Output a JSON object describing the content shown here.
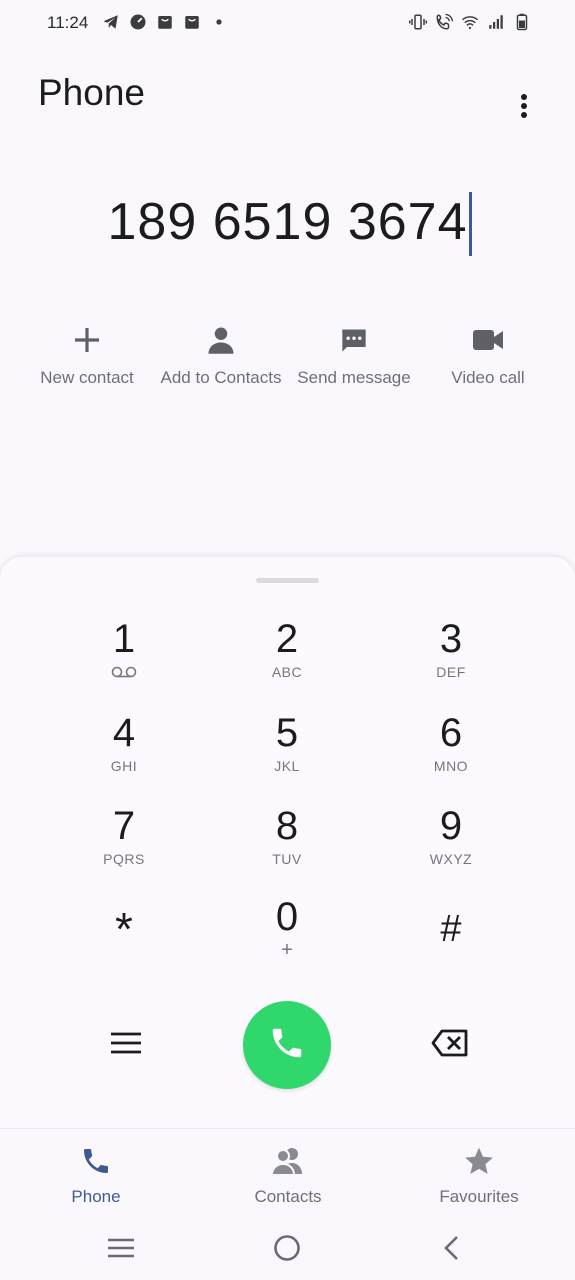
{
  "status_bar": {
    "time": "11:24",
    "left_icons": [
      "telegram-icon",
      "speedometer-icon",
      "shopping-bag-icon",
      "shopping-bag-icon",
      "dot-icon"
    ],
    "right_icons": [
      "vibrate-icon",
      "wifi-call-icon",
      "wifi-icon",
      "signal-icon",
      "battery-icon"
    ]
  },
  "header": {
    "title": "Phone",
    "more_icon": "more-vert-icon"
  },
  "dialer": {
    "number": "189 6519 3674"
  },
  "actions": [
    {
      "label": "New contact",
      "icon": "plus-icon"
    },
    {
      "label": "Add to Contacts",
      "icon": "person-icon"
    },
    {
      "label": "Send message",
      "icon": "message-icon"
    },
    {
      "label": "Video call",
      "icon": "videocam-icon"
    }
  ],
  "keypad": [
    {
      "digit": "1",
      "letters": "",
      "extra": "voicemail"
    },
    {
      "digit": "2",
      "letters": "ABC"
    },
    {
      "digit": "3",
      "letters": "DEF"
    },
    {
      "digit": "4",
      "letters": "GHI"
    },
    {
      "digit": "5",
      "letters": "JKL"
    },
    {
      "digit": "6",
      "letters": "MNO"
    },
    {
      "digit": "7",
      "letters": "PQRS"
    },
    {
      "digit": "8",
      "letters": "TUV"
    },
    {
      "digit": "9",
      "letters": "WXYZ"
    },
    {
      "digit": "*",
      "letters": ""
    },
    {
      "digit": "0",
      "letters": "+"
    },
    {
      "digit": "#",
      "letters": ""
    }
  ],
  "controls": {
    "menu_icon": "menu-icon",
    "call_icon": "phone-icon",
    "backspace_icon": "backspace-icon",
    "call_color": "#2fd76d"
  },
  "bottom_nav": [
    {
      "label": "Phone",
      "icon": "phone-icon",
      "active": true
    },
    {
      "label": "Contacts",
      "icon": "contacts-icon",
      "active": false
    },
    {
      "label": "Favourites",
      "icon": "star-icon",
      "active": false
    }
  ],
  "colors": {
    "accent": "#3f5a93",
    "call": "#2fd76d",
    "muted": "#6f6f76"
  }
}
